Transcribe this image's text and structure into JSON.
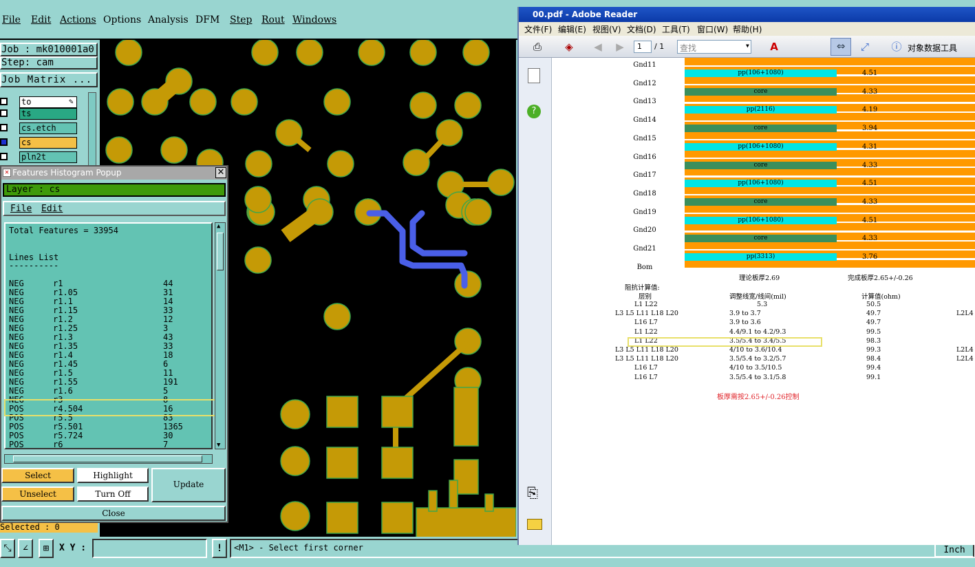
{
  "cam": {
    "menu": [
      "File",
      "Edit",
      "Actions",
      "Options",
      "Analysis",
      "DFM",
      "Step",
      "Rout",
      "Windows"
    ],
    "job_label": "Job : mk010001a0",
    "step_label": "Step: cam",
    "job_matrix_button": "Job Matrix ...",
    "layers": [
      {
        "name": "to",
        "color": "#ffffff"
      },
      {
        "name": "ts",
        "color": "#29a884"
      },
      {
        "name": "cs.etch",
        "color": "#63c3b3"
      },
      {
        "name": "cs",
        "color": "#f5c046"
      },
      {
        "name": "pln2t",
        "color": "#63c3b3"
      }
    ],
    "selected_status": "Selected : 0",
    "xy_label": "X Y :",
    "xy_value": "",
    "prompt": "<M1> - Select first corner",
    "units": "Inch"
  },
  "popup": {
    "title": "Features Histogram Popup",
    "close_glyph": "✕",
    "layer": "Layer :  cs",
    "menu": [
      "File",
      "Edit"
    ],
    "total": "Total Features = 33954",
    "list_heading": "Lines List",
    "list_divider": "----------",
    "rows": [
      {
        "pol": "NEG",
        "sym": "r1",
        "cnt": "44"
      },
      {
        "pol": "NEG",
        "sym": "r1.05",
        "cnt": "31"
      },
      {
        "pol": "NEG",
        "sym": "r1.1",
        "cnt": "14"
      },
      {
        "pol": "NEG",
        "sym": "r1.15",
        "cnt": "33"
      },
      {
        "pol": "NEG",
        "sym": "r1.2",
        "cnt": "12"
      },
      {
        "pol": "NEG",
        "sym": "r1.25",
        "cnt": "3"
      },
      {
        "pol": "NEG",
        "sym": "r1.3",
        "cnt": "43"
      },
      {
        "pol": "NEG",
        "sym": "r1.35",
        "cnt": "33"
      },
      {
        "pol": "NEG",
        "sym": "r1.4",
        "cnt": "18"
      },
      {
        "pol": "NEG",
        "sym": "r1.45",
        "cnt": "6"
      },
      {
        "pol": "NEG",
        "sym": "r1.5",
        "cnt": "11"
      },
      {
        "pol": "NEG",
        "sym": "r1.55",
        "cnt": "191"
      },
      {
        "pol": "NEG",
        "sym": "r1.6",
        "cnt": "5"
      },
      {
        "pol": "NEG",
        "sym": "r3",
        "cnt": "8"
      },
      {
        "pol": "POS",
        "sym": "r4.504",
        "cnt": "16"
      },
      {
        "pol": "POS",
        "sym": "r5.5",
        "cnt": "83"
      },
      {
        "pol": "POS",
        "sym": "r5.501",
        "cnt": "1365"
      },
      {
        "pol": "POS",
        "sym": "r5.724",
        "cnt": "30"
      },
      {
        "pol": "POS",
        "sym": "r6",
        "cnt": "7"
      }
    ],
    "buttons": {
      "select": "Select",
      "highlight": "Highlight",
      "unselect": "Unselect",
      "turn_off": "Turn Off",
      "update": "Update",
      "close": "Close"
    }
  },
  "reader": {
    "title": "00.pdf - Adobe Reader",
    "menu": [
      "文件(F)",
      "编辑(E)",
      "视图(V)",
      "文档(D)",
      "工具(T)",
      "窗口(W)",
      "帮助(H)"
    ],
    "page_current": "1",
    "page_total": "/ 1",
    "search_placeholder": "查找",
    "object_data_tool": "对象数据工具",
    "stack_layers": [
      "Gnd11",
      "Gnd12",
      "Gnd13",
      "Gnd14",
      "Gnd15",
      "Gnd16",
      "Gnd17",
      "Gnd18",
      "Gnd19",
      "Gnd20",
      "Gnd21",
      "Bom"
    ],
    "dielectrics": [
      {
        "material": "pp(106+1080)",
        "thickness": "4.51",
        "color": "#00e5e5"
      },
      {
        "material": "core",
        "thickness": "4.33",
        "color": "#3a8f5c"
      },
      {
        "material": "pp(2116)",
        "thickness": "4.19",
        "color": "#00e5e5"
      },
      {
        "material": "core",
        "thickness": "3.94",
        "color": "#3a8f5c"
      },
      {
        "material": "pp(106+1080)",
        "thickness": "4.31",
        "color": "#00e5e5"
      },
      {
        "material": "core",
        "thickness": "4.33",
        "color": "#3a8f5c"
      },
      {
        "material": "pp(106+1080)",
        "thickness": "4.51",
        "color": "#00e5e5"
      },
      {
        "material": "core",
        "thickness": "4.33",
        "color": "#3a8f5c"
      },
      {
        "material": "pp(106+1080)",
        "thickness": "4.51",
        "color": "#00e5e5"
      },
      {
        "material": "core",
        "thickness": "4.33",
        "color": "#3a8f5c"
      },
      {
        "material": "pp(3313)",
        "thickness": "3.76",
        "color": "#00e5e5"
      }
    ],
    "theory_thickness": "理论板厚2.69",
    "finish_thickness": "完成板厚2.65+/-0.26",
    "impedance_title": "阻抗计算值:",
    "imp_headers": {
      "layer": "层别",
      "width": "调整线宽/线间(mil)",
      "value": "计算值(ohm)"
    },
    "imp_rows": [
      {
        "layer": "L1 L22",
        "width": "5.3",
        "value": "50.5",
        "ref": ""
      },
      {
        "layer": "L3 L5 L11 L18 L20",
        "width": "3.9 to 3.7",
        "value": "49.7",
        "ref": "L2L4"
      },
      {
        "layer": "L16 L7",
        "width": "3.9 to 3.6",
        "value": "49.7",
        "ref": ""
      },
      {
        "layer": "L1 L22",
        "width": "4.4/9.1 to 4.2/9.3",
        "value": "99.5",
        "ref": ""
      },
      {
        "layer": "L1 L22",
        "width": "3.5/5.4 to 3.4/5.5",
        "value": "98.3",
        "ref": ""
      },
      {
        "layer": "L3 L5 L11 L18 L20",
        "width": "4/10 to 3.6/10.4",
        "value": "99.3",
        "ref": "L2L4"
      },
      {
        "layer": "L3 L5 L11 L18 L20",
        "width": "3.5/5.4 to 3.2/5.7",
        "value": "98.4",
        "ref": "L2L4"
      },
      {
        "layer": "L16 L7",
        "width": "4/10 to 3.5/10.5",
        "value": "99.4",
        "ref": ""
      },
      {
        "layer": "L16 L7",
        "width": "3.5/5.4 to 3.1/5.8",
        "value": "99.1",
        "ref": ""
      }
    ],
    "note": "板厚需按2.65+/-0.26控制"
  },
  "colors": {
    "pcb_copper": "#c59a06",
    "pcb_outline": "#3fa64a",
    "trace_selected": "#4a5fe8",
    "highlight": "#e8e06a"
  }
}
